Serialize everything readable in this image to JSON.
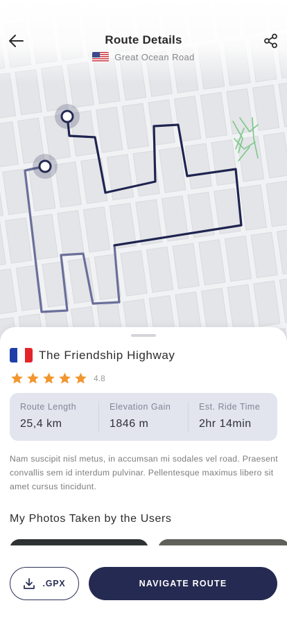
{
  "header": {
    "title": "Route Details",
    "subtitle": "Great Ocean Road",
    "subtitle_flag": "us-flag-icon",
    "back_icon": "arrow-left-icon",
    "share_icon": "share-icon"
  },
  "map": {
    "route_color": "#252a52",
    "route_fade_color": "#6b6f9a",
    "marker_color": "#252a52",
    "park_color": "#6cc27a"
  },
  "route": {
    "flag": "fr-flag-icon",
    "name": "The Friendship Highway",
    "rating": 4.8,
    "rating_label": "4.8",
    "star_color": "#f2962e"
  },
  "stats": [
    {
      "label": "Route Length",
      "value": "25,4 km"
    },
    {
      "label": "Elevation Gain",
      "value": "1846 m"
    },
    {
      "label": "Est. Ride Time",
      "value": "2hr 14min"
    }
  ],
  "description": "Nam suscipit nisl metus, in accumsan mi sodales vel road. Praesent convallis sem id interdum pulvinar. Pellentesque maximus libero sit amet cursus tincidunt.",
  "photos": {
    "title": "My Photos Taken by the Users"
  },
  "actions": {
    "gpx_label": ".GPX",
    "gpx_icon": "download-icon",
    "navigate_label": "NAVIGATE ROUTE",
    "primary_color": "#252a52"
  }
}
